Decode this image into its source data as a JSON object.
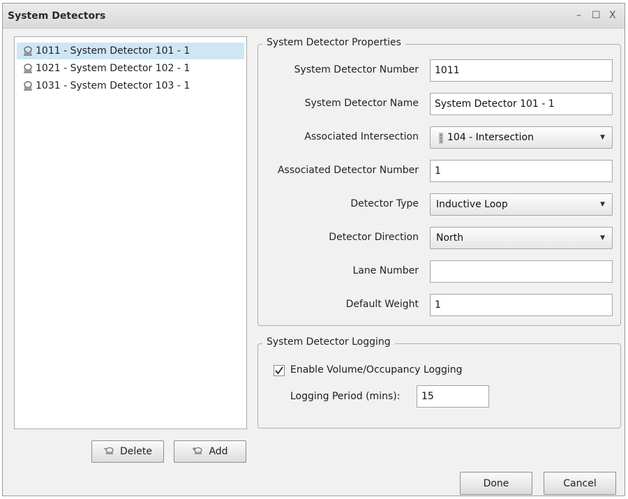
{
  "window": {
    "title": "System Detectors",
    "controls": {
      "minimize": "–",
      "maximize": "☐",
      "close": "X"
    }
  },
  "detector_list": [
    {
      "label": "1011 - System Detector 101 - 1",
      "selected": true
    },
    {
      "label": "1021 - System Detector 102 - 1",
      "selected": false
    },
    {
      "label": "1031 - System Detector 103 - 1",
      "selected": false
    }
  ],
  "list_buttons": {
    "delete": "Delete",
    "add": "Add"
  },
  "properties": {
    "group_title": "System Detector Properties",
    "number": {
      "label": "System Detector Number",
      "value": "1011"
    },
    "name": {
      "label": "System Detector Name",
      "value": "System Detector 101 - 1"
    },
    "intersection": {
      "label": "Associated Intersection",
      "value": "104 - Intersection"
    },
    "assoc_number": {
      "label": "Associated Detector Number",
      "value": "1"
    },
    "type": {
      "label": "Detector Type",
      "value": "Inductive Loop"
    },
    "direction": {
      "label": "Detector Direction",
      "value": "North"
    },
    "lane": {
      "label": "Lane Number",
      "value": ""
    },
    "weight": {
      "label": "Default Weight",
      "value": "1"
    }
  },
  "logging": {
    "group_title": "System Detector Logging",
    "enable_label": "Enable Volume/Occupancy Logging",
    "enabled": true,
    "period_label": "Logging Period (mins):",
    "period_value": "15"
  },
  "footer": {
    "done": "Done",
    "cancel": "Cancel"
  },
  "colors": {
    "selection": "#cfe6f5",
    "window_bg": "#f1f1f1"
  }
}
